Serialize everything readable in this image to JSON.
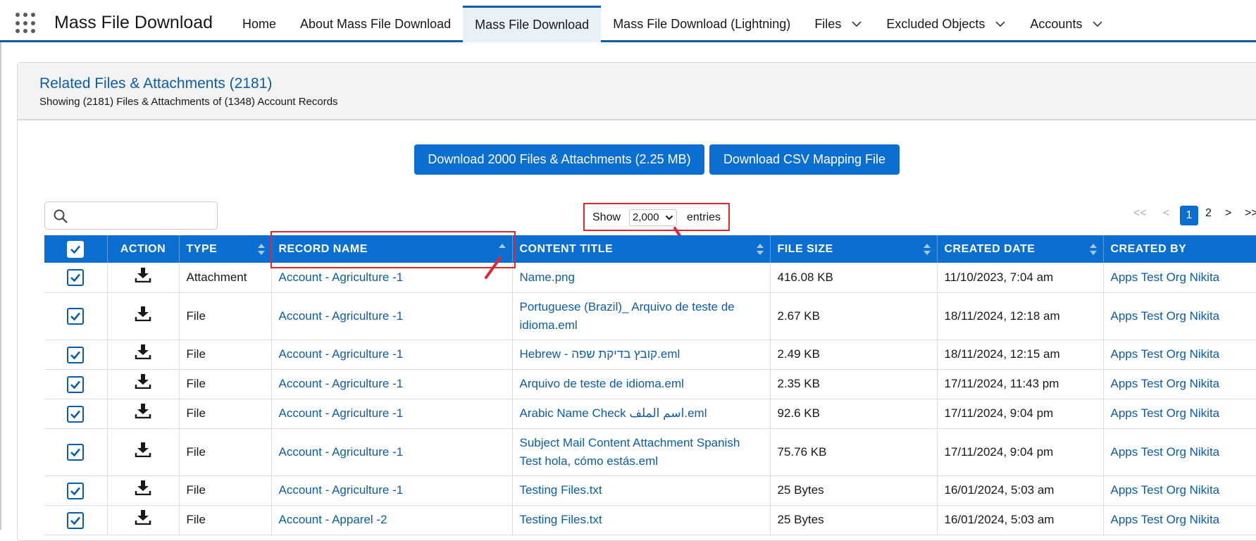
{
  "app": {
    "name": "Mass File Download"
  },
  "nav": {
    "tabs": [
      {
        "label": "Home"
      },
      {
        "label": "About Mass File Download"
      },
      {
        "label": "Mass File Download"
      },
      {
        "label": "Mass File Download (Lightning)"
      },
      {
        "label": "Files"
      },
      {
        "label": "Excluded Objects"
      },
      {
        "label": "Accounts"
      }
    ],
    "active_tab": "Mass File Download"
  },
  "card": {
    "title": "Related Files & Attachments (2181)",
    "subtitle": "Showing (2181) Files & Attachments of (1348) Account Records"
  },
  "buttons": {
    "download_files": "Download 2000 Files & Attachments (2.25 MB)",
    "download_csv": "Download CSV Mapping File"
  },
  "search": {
    "placeholder": ""
  },
  "entries": {
    "show_label": "Show",
    "value": "2,000",
    "suffix": "entries"
  },
  "pagination": {
    "first": "<<",
    "prev": "<",
    "pages": [
      "1",
      "2"
    ],
    "current": "1",
    "next": ">",
    "last": ">>"
  },
  "table": {
    "columns": [
      "ACTION",
      "TYPE",
      "RECORD NAME",
      "CONTENT TITLE",
      "FILE SIZE",
      "CREATED DATE",
      "CREATED BY"
    ],
    "rows": [
      {
        "type": "Attachment",
        "record": "Account - Agriculture -1",
        "title": "Name.png",
        "size": "416.08 KB",
        "date": "11/10/2023, 7:04 am",
        "by": "Apps Test Org Nikita"
      },
      {
        "type": "File",
        "record": "Account - Agriculture -1",
        "title": "Portuguese (Brazil)_ Arquivo de teste de idioma.eml",
        "size": "2.67 KB",
        "date": "18/11/2024, 12:18 am",
        "by": "Apps Test Org Nikita"
      },
      {
        "type": "File",
        "record": "Account - Agriculture -1",
        "title": "Hebrew - קובץ בדיקת שפה.eml",
        "size": "2.49 KB",
        "date": "18/11/2024, 12:15 am",
        "by": "Apps Test Org Nikita"
      },
      {
        "type": "File",
        "record": "Account - Agriculture -1",
        "title": "Arquivo de teste de idioma.eml",
        "size": "2.35 KB",
        "date": "17/11/2024, 11:43 pm",
        "by": "Apps Test Org Nikita"
      },
      {
        "type": "File",
        "record": "Account - Agriculture -1",
        "title": "Arabic Name Check اسم الملف.eml",
        "size": "92.6 KB",
        "date": "17/11/2024, 9:04 pm",
        "by": "Apps Test Org Nikita"
      },
      {
        "type": "File",
        "record": "Account - Agriculture -1",
        "title": "Subject Mail Content Attachment Spanish Test hola, cómo estás.eml",
        "size": "75.76 KB",
        "date": "17/11/2024, 9:04 pm",
        "by": "Apps Test Org Nikita"
      },
      {
        "type": "File",
        "record": "Account - Agriculture -1",
        "title": "Testing Files.txt",
        "size": "25 Bytes",
        "date": "16/01/2024, 5:03 am",
        "by": "Apps Test Org Nikita"
      },
      {
        "type": "File",
        "record": "Account - Apparel -2",
        "title": "Testing Files.txt",
        "size": "25 Bytes",
        "date": "16/01/2024, 5:03 am",
        "by": "Apps Test Org Nikita"
      }
    ]
  },
  "colors": {
    "brand": "#0b6fd1",
    "link": "#0b5cab",
    "highlight": "#e3262d"
  },
  "icons": [
    "app-launcher-icon",
    "chevron-down-icon",
    "search-icon",
    "download-icon",
    "checkbox-checked-icon",
    "sort-icon"
  ]
}
